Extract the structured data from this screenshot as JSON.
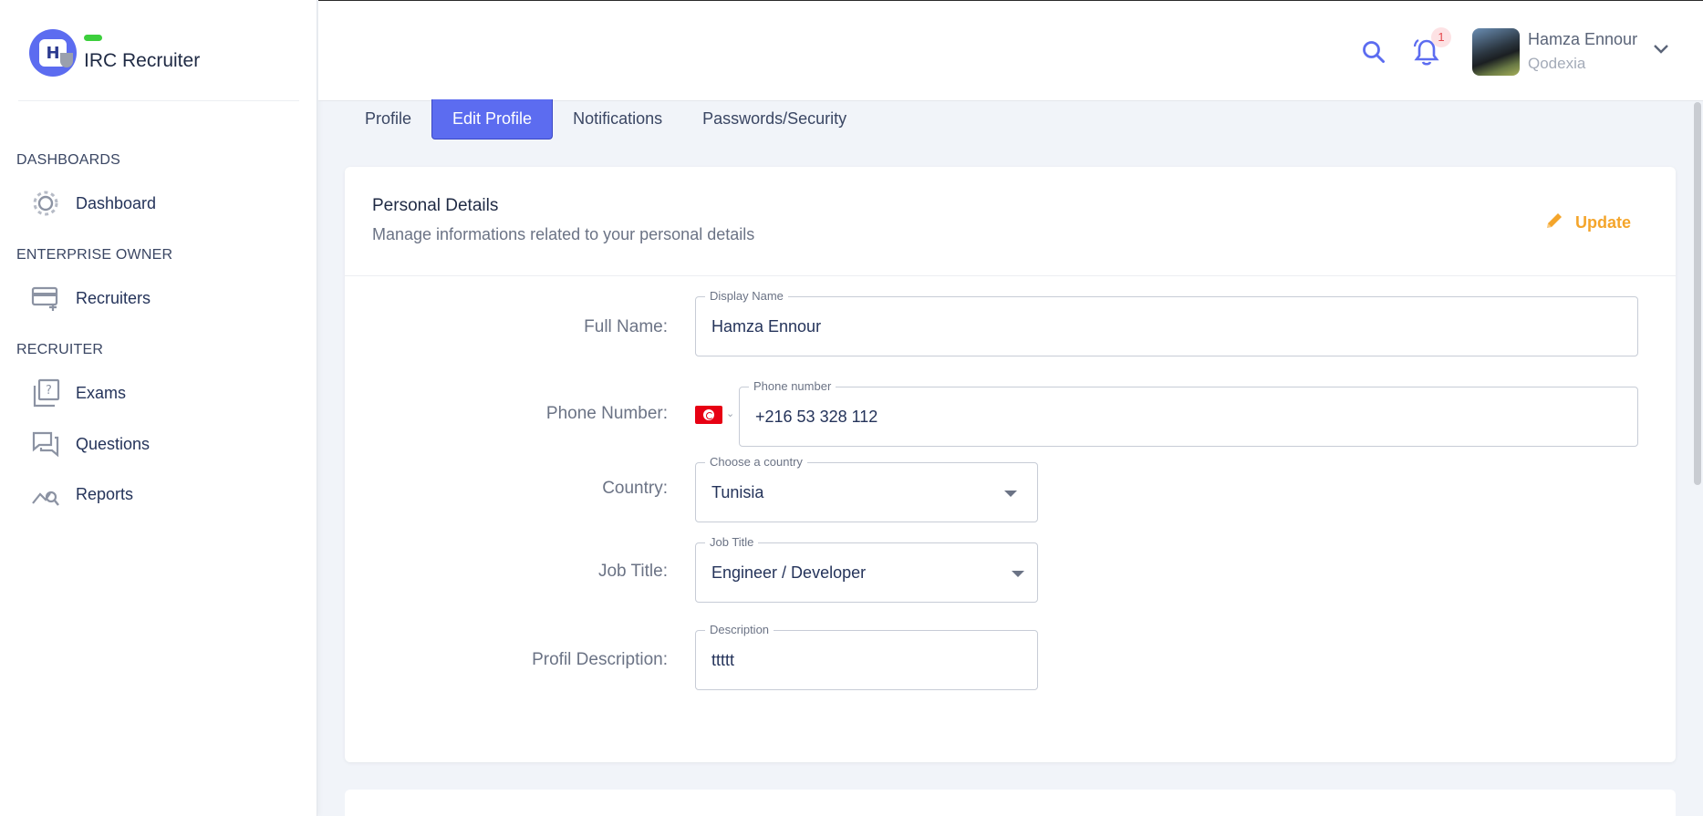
{
  "brand": {
    "name": "IRC Recruiter",
    "logo_letter": "H"
  },
  "sidebar": {
    "sections": [
      {
        "title": "DASHBOARDS",
        "items": [
          {
            "label": "Dashboard",
            "icon": "gear-icon"
          }
        ]
      },
      {
        "title": "ENTERPRISE OWNER",
        "items": [
          {
            "label": "Recruiters",
            "icon": "card-add-icon"
          }
        ]
      },
      {
        "title": "RECRUITER",
        "items": [
          {
            "label": "Exams",
            "icon": "exam-icon"
          },
          {
            "label": "Questions",
            "icon": "chat-icon"
          },
          {
            "label": "Reports",
            "icon": "chart-search-icon"
          }
        ]
      }
    ]
  },
  "header": {
    "notification_count": "1",
    "user": {
      "name": "Hamza Ennour",
      "org": "Qodexia"
    },
    "accent_color": "#5c6cf0"
  },
  "tabs": [
    {
      "label": "Profile",
      "active": false
    },
    {
      "label": "Edit Profile",
      "active": true
    },
    {
      "label": "Notifications",
      "active": false
    },
    {
      "label": "Passwords/Security",
      "active": false
    }
  ],
  "card": {
    "title": "Personal Details",
    "subtitle": "Manage informations related to your personal details",
    "update_label": "Update",
    "update_color": "#f4a52b"
  },
  "form": {
    "full_name": {
      "label": "Full Name:",
      "legend": "Display Name",
      "value": "Hamza Ennour"
    },
    "phone": {
      "label": "Phone Number:",
      "legend": "Phone number",
      "value": "+216 53 328 112",
      "flag": "tunisia-flag-icon"
    },
    "country": {
      "label": "Country:",
      "legend": "Choose a country",
      "value": "Tunisia"
    },
    "job_title": {
      "label": "Job Title:",
      "legend": "Job Title",
      "value": "Engineer / Developer"
    },
    "description": {
      "label": "Profil Description:",
      "legend": "Description",
      "value": "ttttt"
    }
  }
}
